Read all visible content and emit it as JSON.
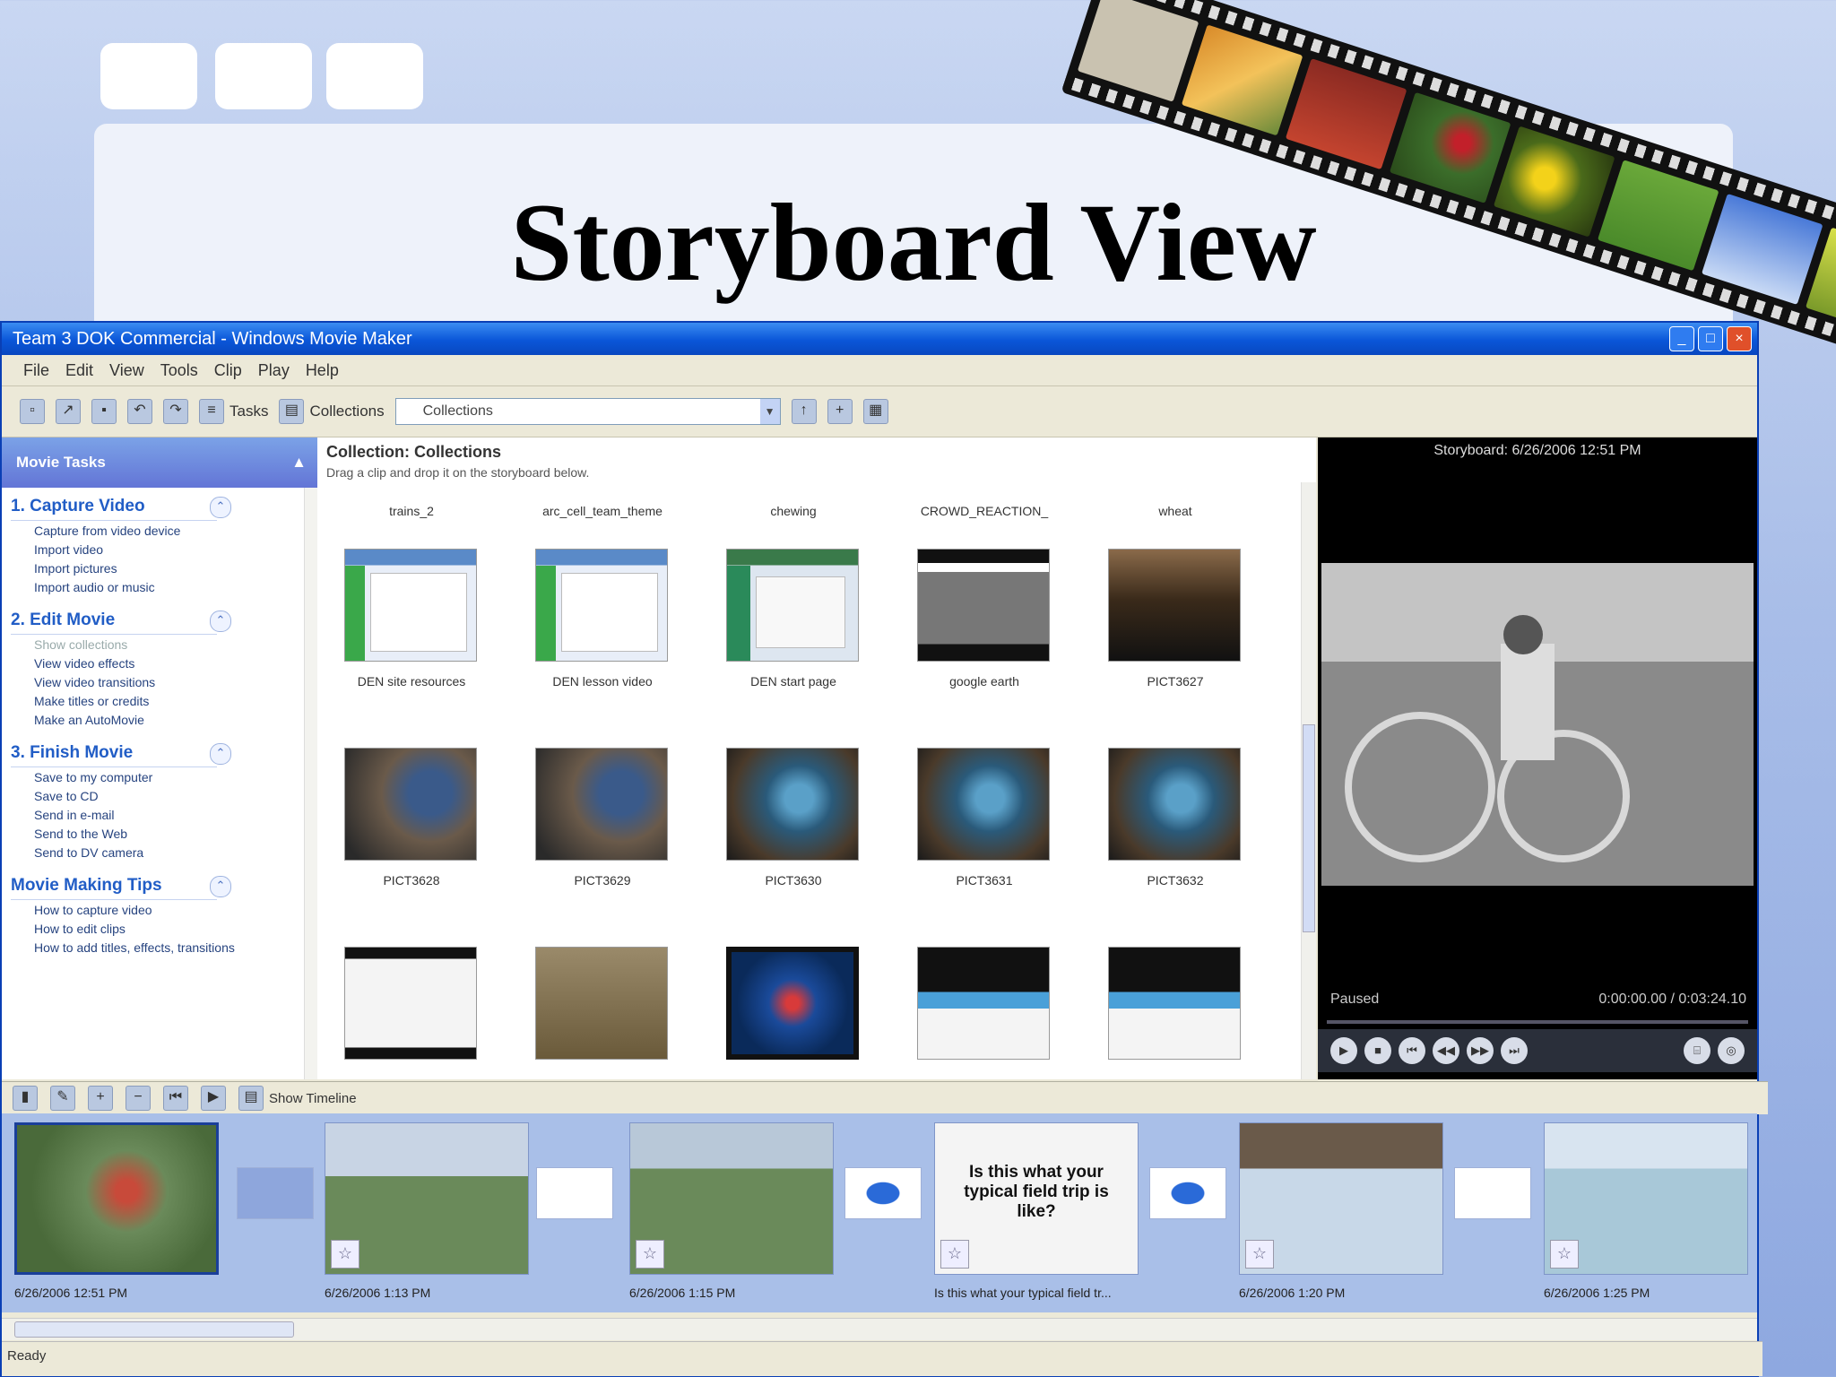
{
  "slide": {
    "title": "Storyboard View"
  },
  "window": {
    "title": "Team 3 DOK Commercial - Windows Movie Maker",
    "menu": [
      "File",
      "Edit",
      "View",
      "Tools",
      "Clip",
      "Play",
      "Help"
    ],
    "toolbar": {
      "tasks_label": "Tasks",
      "collections_label": "Collections",
      "combo_value": "Collections"
    }
  },
  "taskpane": {
    "header": "Movie Tasks",
    "sections": [
      {
        "title": "1. Capture Video",
        "items": [
          "Capture from video device",
          "Import video",
          "Import pictures",
          "Import audio or music"
        ]
      },
      {
        "title": "2. Edit Movie",
        "items": [
          "Show collections",
          "View video effects",
          "View video transitions",
          "Make titles or credits",
          "Make an AutoMovie"
        ]
      },
      {
        "title": "3. Finish Movie",
        "items": [
          "Save to my computer",
          "Save to CD",
          "Send in e-mail",
          "Send to the Web",
          "Send to DV camera"
        ]
      },
      {
        "title": "Movie Making Tips",
        "items": [
          "How to capture video",
          "How to edit clips",
          "How to add titles, effects, transitions"
        ]
      }
    ]
  },
  "collection": {
    "title": "Collection: Collections",
    "subtitle": "Drag a clip and drop it on the storyboard below.",
    "top_labels": [
      "trains_2",
      "arc_cell_team_theme",
      "chewing",
      "CROWD_REACTION_",
      "wheat"
    ],
    "rows": [
      [
        "DEN site resources",
        "DEN lesson video",
        "DEN start page",
        "google earth",
        "PICT3627"
      ],
      [
        "PICT3628",
        "PICT3629",
        "PICT3630",
        "PICT3631",
        "PICT3632"
      ]
    ]
  },
  "monitor": {
    "title": "Storyboard: 6/26/2006 12:51 PM",
    "status": "Paused",
    "time": "0:00:00.00 / 0:03:24.10"
  },
  "storyboard": {
    "toolbar_label": "Show Timeline",
    "title_card_text": "Is this what your typical field trip is like?",
    "captions": [
      "6/26/2006 12:51 PM",
      "6/26/2006 1:13 PM",
      "6/26/2006 1:15 PM",
      "Is this what your typical field tr...",
      "6/26/2006 1:20 PM",
      "6/26/2006 1:25 PM"
    ]
  },
  "statusbar": {
    "text": "Ready"
  },
  "colors": {
    "titlebar": "#0a56d8",
    "storyboard_bg": "#a9bfe8",
    "task_header": "#6375d6"
  }
}
